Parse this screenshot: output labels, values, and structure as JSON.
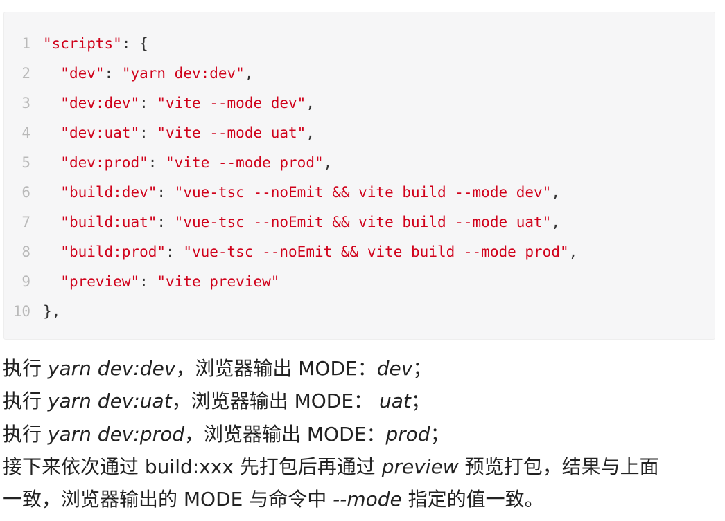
{
  "code": {
    "lines": [
      {
        "num": "1",
        "key": "\"scripts\"",
        "sep": ": ",
        "val": "",
        "end": "{"
      },
      {
        "num": "2",
        "key": "\"dev\"",
        "sep": ": ",
        "val": "\"yarn dev:dev\"",
        "end": ","
      },
      {
        "num": "3",
        "key": "\"dev:dev\"",
        "sep": ": ",
        "val": "\"vite --mode dev\"",
        "end": ","
      },
      {
        "num": "4",
        "key": "\"dev:uat\"",
        "sep": ": ",
        "val": "\"vite --mode uat\"",
        "end": ","
      },
      {
        "num": "5",
        "key": "\"dev:prod\"",
        "sep": ": ",
        "val": "\"vite --mode prod\"",
        "end": ","
      },
      {
        "num": "6",
        "key": "\"build:dev\"",
        "sep": ": ",
        "val": "\"vue-tsc --noEmit && vite build --mode dev\"",
        "end": ","
      },
      {
        "num": "7",
        "key": "\"build:uat\"",
        "sep": ": ",
        "val": "\"vue-tsc --noEmit && vite build --mode uat\"",
        "end": ","
      },
      {
        "num": "8",
        "key": "\"build:prod\"",
        "sep": ": ",
        "val": "\"vue-tsc --noEmit && vite build --mode prod\"",
        "end": ","
      },
      {
        "num": "9",
        "key": "\"preview\"",
        "sep": ": ",
        "val": "\"vite preview\"",
        "end": ""
      },
      {
        "num": "10",
        "key": "",
        "sep": "",
        "val": "",
        "end": "},"
      }
    ]
  },
  "paragraphs": {
    "p1": {
      "a": "执行 ",
      "b": "yarn dev:dev",
      "c": "，浏览器输出 MODE：",
      "d": "dev",
      "e": "；"
    },
    "p2": {
      "a": "执行 ",
      "b": "yarn dev:uat",
      "c": "，浏览器输出 MODE： ",
      "d": "uat",
      "e": "；"
    },
    "p3": {
      "a": "执行 ",
      "b": "yarn dev:prod",
      "c": "，浏览器输出 MODE：",
      "d": "prod",
      "e": "；"
    },
    "p4": {
      "a": "接下来依次通过 build:xxx 先打包后再通过 ",
      "b": "preview",
      "c": " 预览打包，结果与上面"
    },
    "p5": {
      "a": "一致，浏览器输出的 MODE 与命令中 ",
      "b": "--mode",
      "c": " 指定的值一致。"
    }
  }
}
